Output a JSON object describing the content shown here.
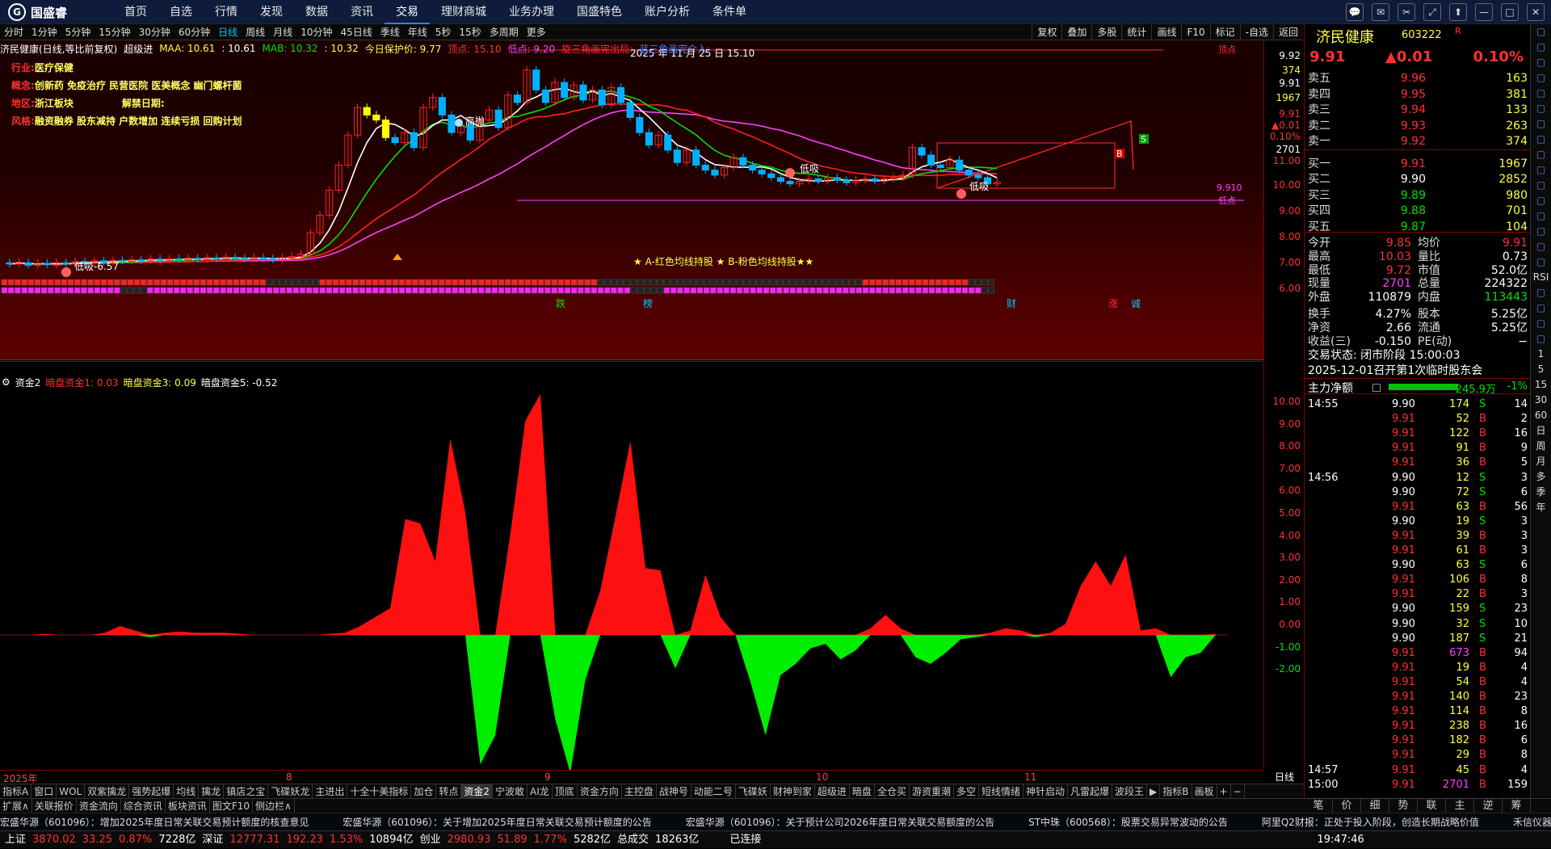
{
  "app": {
    "brand": "国盛睿"
  },
  "menu": [
    "首页",
    "自选",
    "行情",
    "发现",
    "数据",
    "资讯",
    "交易",
    "理财商城",
    "业务办理",
    "国盛特色",
    "账户分析",
    "条件单"
  ],
  "window_controls": [
    "💬",
    "✉",
    "✂",
    "⤢",
    "⬆",
    "—",
    "□",
    "✕"
  ],
  "periods": [
    "分时",
    "1分钟",
    "5分钟",
    "15分钟",
    "30分钟",
    "60分钟",
    "日线",
    "周线",
    "月线",
    "10分钟",
    "45日线",
    "季线",
    "年线",
    "5秒",
    "15秒",
    "多周期",
    "更多"
  ],
  "period_active": "日线",
  "tools": [
    "复权",
    "叠加",
    "多股",
    "统计",
    "画线",
    "F10",
    "标记",
    "-自选",
    "返回"
  ],
  "k_title": {
    "name": "济民健康(日线,等比前复权)",
    "indicator": "超级进",
    "maa": "MAA: 10.61",
    "maa2": ": 10.61",
    "mab": "MAB: 10.32",
    "mab2": ": 10.32",
    "protect": "今日保护价: 9.77",
    "top": "顶点: 15.10",
    "low": "低点: 9.20",
    "tri1": "旋三角画完出局:",
    "tri2": "蓝三角画完介入:"
  },
  "info": {
    "industry_label": "行业:",
    "industry": "医疗保健",
    "concept_label": "概念:",
    "concept": "创新药 免疫治疗 民营医院 医美概念 幽门螺杆菌",
    "region_label": "地区:",
    "region": "浙江板块",
    "unlock_label": "解禁日期:",
    "unlock": "",
    "style_label": "风格:",
    "style": "融资融券 股东减持 户数增加 连续亏损 回购计划"
  },
  "k_annotations": {
    "date_peak": "2025 年 11 月 25 日 15.10",
    "high_throw": "高抛",
    "low_buy1": "低吸",
    "low_buy2": "低吸",
    "low_buy3": "低吸",
    "start_low": "低吸-6.57",
    "note": "★ A-红色均线持股 ★ B-粉色均线持股★★",
    "top_tag": "顶点",
    "bottom_tag": "低点",
    "last_price": "9.910",
    "s_tag": "S",
    "b_tag": "B"
  },
  "k_axis": [
    {
      "v": "9.92",
      "c": "#fff"
    },
    {
      "v": "374",
      "c": "#ffff40"
    },
    {
      "v": "9.91",
      "c": "#fff"
    },
    {
      "v": "1967",
      "c": "#ffff40"
    },
    {
      "v": "9.91",
      "c": "#ff3030"
    },
    {
      "v": "▲0.01",
      "c": "#ff3030"
    },
    {
      "v": "0.10%",
      "c": "#ff3030"
    },
    {
      "v": "2701",
      "c": "#fff"
    },
    {
      "v": "11.00",
      "c": "#ff3030"
    },
    {
      "v": "10.00",
      "c": "#ff3030"
    },
    {
      "v": "9.00",
      "c": "#ff3030"
    },
    {
      "v": "8.00",
      "c": "#ff3030"
    },
    {
      "v": "7.00",
      "c": "#ff3030"
    },
    {
      "v": "6.00",
      "c": "#ff3030"
    }
  ],
  "signal_words": [
    "跌",
    "榜",
    "财",
    "涨",
    "诚"
  ],
  "sub_title": {
    "name": "资金2",
    "a": "暗盘资金1: 0.03",
    "b": "暗盘资金3: 0.09",
    "c": "暗盘资金5: -0.52"
  },
  "sub_axis": [
    "10.00",
    "9.00",
    "8.00",
    "7.00",
    "6.00",
    "5.00",
    "4.00",
    "3.00",
    "2.00",
    "1.00",
    "0.00",
    "-1.00",
    "-2.00"
  ],
  "x_axis": [
    "2025年",
    "8",
    "9",
    "10",
    "11"
  ],
  "dayline": "日线",
  "indicator_tabs": [
    "指标A",
    "窗口",
    "WOL",
    "双紫擒龙",
    "强势起爆",
    "均线",
    "擒龙",
    "镇店之宝",
    "飞碟妖龙",
    "主进出",
    "十全十美指标",
    "加仓",
    "转点",
    "资金2",
    "宁波敢",
    "AI龙",
    "顶底",
    "资金方向",
    "主控盘",
    "战神号",
    "动能二号",
    "飞碟妖",
    "财神到家",
    "超级进",
    "暗盘",
    "全仓买",
    "游资重潮",
    "多空",
    "短线情绪",
    "神针启动",
    "凡雷起爆",
    "波段王",
    "▶",
    "指标B",
    "画板",
    "+",
    "−"
  ],
  "bottom_tabs": [
    "扩展∧",
    "关联报价",
    "资金流向",
    "综合资讯",
    "板块资讯",
    "图文F10",
    "侧边栏∧"
  ],
  "news": [
    "宏盛华源（601096）：增加2025年度日常关联交易预计额度的核查意见",
    "宏盛华源（601096）：关于增加2025年度日常关联交易预计额度的公告",
    "宏盛华源（601096）：关于预计公司2026年度日常关联交易额度的公告",
    "ST中珠（600568）：股票交易异常波动的公告",
    "阿里Q2财报：正处于投入阶段，创造长期战略价值",
    "禾信仪器（688"
  ],
  "status": {
    "sh": "上证",
    "sh_v": "3870.02",
    "sh_c": "33.25",
    "sh_p": "0.87%",
    "sh_a": "7228亿",
    "sz": "深证",
    "sz_v": "12777.31",
    "sz_c": "192.23",
    "sz_p": "1.53%",
    "sz_a": "10894亿",
    "cy": "创业",
    "cy_v": "2980.93",
    "cy_c": "51.89",
    "cy_p": "1.77%",
    "cy_a": "5282亿",
    "total": "总成交",
    "total_v": "18263亿",
    "conn": "已连接",
    "time": "19:47:46"
  },
  "quote": {
    "name": "济民健康",
    "code": "603222",
    "r": "R",
    "price": "9.91",
    "change": "▲0.01",
    "pct": "0.10%"
  },
  "order_book": [
    {
      "l": "卖五",
      "p": "9.96",
      "v": "163"
    },
    {
      "l": "卖四",
      "p": "9.95",
      "v": "381"
    },
    {
      "l": "卖三",
      "p": "9.94",
      "v": "133"
    },
    {
      "l": "卖二",
      "p": "9.93",
      "v": "263"
    },
    {
      "l": "卖一",
      "p": "9.92",
      "v": "374"
    },
    {
      "l": "买一",
      "p": "9.91",
      "v": "1967"
    },
    {
      "l": "买二",
      "p": "9.90",
      "v": "2852"
    },
    {
      "l": "买三",
      "p": "9.89",
      "v": "980"
    },
    {
      "l": "买四",
      "p": "9.88",
      "v": "701"
    },
    {
      "l": "买五",
      "p": "9.87",
      "v": "104"
    }
  ],
  "stats": [
    {
      "a": "今开",
      "av": "9.85",
      "b": "均价",
      "bv": "9.91"
    },
    {
      "a": "最高",
      "av": "10.03",
      "b": "量比",
      "bv": "0.73"
    },
    {
      "a": "最低",
      "av": "9.72",
      "b": "市值",
      "bv": "52.0亿"
    },
    {
      "a": "现量",
      "av": "2701",
      "b": "总量",
      "bv": "224322"
    },
    {
      "a": "外盘",
      "av": "110879",
      "b": "内盘",
      "bv": "113443"
    },
    {
      "a": "换手",
      "av": "4.27%",
      "b": "股本",
      "bv": "5.25亿"
    },
    {
      "a": "净资",
      "av": "2.66",
      "b": "流通",
      "bv": "5.25亿"
    },
    {
      "a": "收益(三)",
      "av": "-0.150",
      "b": "PE(动)",
      "bv": "−"
    }
  ],
  "trade_state": "交易状态: 闭市阶段 15:00:03",
  "meeting": "2025-12-01召开第1次临时股东会",
  "mainflow": {
    "label": "主力净额",
    "val": "-245.9万",
    "pct": "-1%"
  },
  "ticks": [
    {
      "t": "14:55",
      "p": "9.90",
      "v": "174",
      "d": "S",
      "n": "14"
    },
    {
      "t": "",
      "p": "9.91",
      "v": "52",
      "d": "B",
      "n": "2"
    },
    {
      "t": "",
      "p": "9.91",
      "v": "122",
      "d": "B",
      "n": "16"
    },
    {
      "t": "",
      "p": "9.91",
      "v": "91",
      "d": "B",
      "n": "9"
    },
    {
      "t": "",
      "p": "9.91",
      "v": "36",
      "d": "B",
      "n": "5"
    },
    {
      "t": "14:56",
      "p": "9.90",
      "v": "12",
      "d": "S",
      "n": "3"
    },
    {
      "t": "",
      "p": "9.90",
      "v": "72",
      "d": "S",
      "n": "6"
    },
    {
      "t": "",
      "p": "9.91",
      "v": "63",
      "d": "B",
      "n": "56"
    },
    {
      "t": "",
      "p": "9.90",
      "v": "19",
      "d": "S",
      "n": "3"
    },
    {
      "t": "",
      "p": "9.91",
      "v": "39",
      "d": "B",
      "n": "3"
    },
    {
      "t": "",
      "p": "9.91",
      "v": "61",
      "d": "B",
      "n": "3"
    },
    {
      "t": "",
      "p": "9.90",
      "v": "63",
      "d": "S",
      "n": "6"
    },
    {
      "t": "",
      "p": "9.91",
      "v": "106",
      "d": "B",
      "n": "8"
    },
    {
      "t": "",
      "p": "9.91",
      "v": "22",
      "d": "B",
      "n": "3"
    },
    {
      "t": "",
      "p": "9.90",
      "v": "159",
      "d": "S",
      "n": "23"
    },
    {
      "t": "",
      "p": "9.90",
      "v": "32",
      "d": "S",
      "n": "10"
    },
    {
      "t": "",
      "p": "9.90",
      "v": "187",
      "d": "S",
      "n": "21"
    },
    {
      "t": "",
      "p": "9.91",
      "v": "673",
      "d": "B",
      "n": "94"
    },
    {
      "t": "",
      "p": "9.91",
      "v": "19",
      "d": "B",
      "n": "4"
    },
    {
      "t": "",
      "p": "9.91",
      "v": "54",
      "d": "B",
      "n": "4"
    },
    {
      "t": "",
      "p": "9.91",
      "v": "140",
      "d": "B",
      "n": "23"
    },
    {
      "t": "",
      "p": "9.91",
      "v": "114",
      "d": "B",
      "n": "8"
    },
    {
      "t": "",
      "p": "9.91",
      "v": "238",
      "d": "B",
      "n": "16"
    },
    {
      "t": "",
      "p": "9.91",
      "v": "182",
      "d": "B",
      "n": "6"
    },
    {
      "t": "",
      "p": "9.91",
      "v": "29",
      "d": "B",
      "n": "8"
    },
    {
      "t": "14:57",
      "p": "9.91",
      "v": "45",
      "d": "B",
      "n": "4"
    },
    {
      "t": "15:00",
      "p": "9.91",
      "v": "2701",
      "d": "B",
      "n": "159"
    }
  ],
  "right_bottom_tabs": [
    "笔",
    "价",
    "细",
    "势",
    "联",
    "主",
    "逆",
    "筹"
  ],
  "side_tabs": [
    "",
    "",
    "",
    "",
    "",
    "",
    "",
    "",
    "",
    "",
    "",
    "",
    "",
    "",
    "",
    "",
    "RSI",
    "",
    "",
    "",
    "",
    "1",
    "5",
    "15",
    "30",
    "60",
    "日",
    "周",
    "月",
    "多",
    "季",
    "年"
  ],
  "chart_data": {
    "type": "candlestick",
    "price_axis": [
      6,
      7,
      8,
      9,
      10,
      11
    ],
    "top": 15.1,
    "low": 9.2,
    "last": 9.91,
    "ma_a": 10.61,
    "ma_b": 10.32,
    "flow_axis": [
      -2,
      -1,
      0,
      1,
      2,
      3,
      4,
      5,
      6,
      7,
      8,
      9,
      10
    ],
    "flow_series": [
      0,
      0,
      0,
      0.05,
      0,
      0,
      0,
      0.1,
      0.4,
      0.2,
      -0.1,
      0.1,
      0.15,
      0.1,
      0.1,
      0.1,
      0.05,
      0,
      0,
      0,
      0,
      0,
      0.05,
      0.1,
      0.4,
      0.8,
      1.2,
      5.2,
      5.0,
      3.3,
      8.8,
      5.5,
      -5.8,
      -4.5,
      4.5,
      9.6,
      10.8,
      -3.8,
      -6.2,
      -2.0,
      2.0,
      5.3,
      8.7,
      3.0,
      2.9,
      -1.5,
      0.2,
      2.7,
      0.8,
      0,
      -2.1,
      -4.5,
      -1.8,
      -1.3,
      -0.6,
      -0.4,
      -1.1,
      -0.7,
      0.3,
      0.9,
      0.3,
      -1.0,
      -1.3,
      -0.8,
      -0.2,
      -0.1,
      0.1,
      0.3,
      0.2,
      -0.1,
      0.1,
      0.5,
      2.2,
      3.3,
      2.2,
      3.6,
      0.2,
      0.3,
      -1.9,
      -1.0,
      -0.8,
      0.05
    ]
  }
}
